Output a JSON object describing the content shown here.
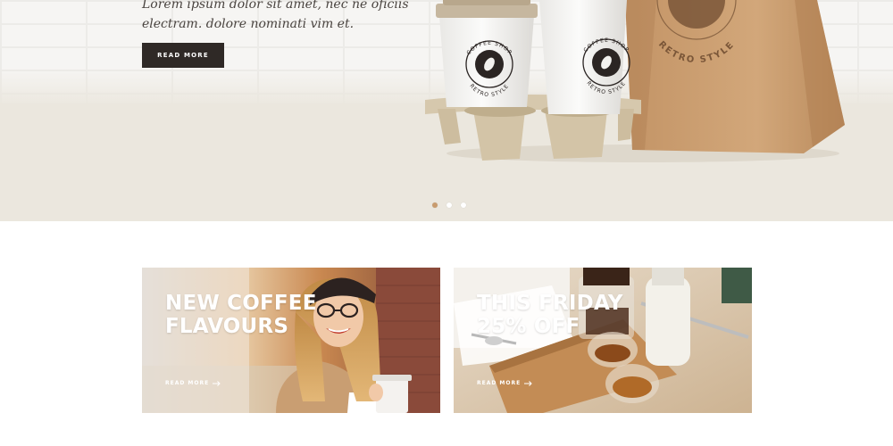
{
  "hero": {
    "text_line1": "Lorem ipsum dolor sit amet, nec ne oficiis",
    "text_line2": "electram. dolore nominati vim et.",
    "button_label": "READ MORE",
    "products": {
      "cup_label_top": "COFFEE SHOP",
      "cup_label_bottom": "RETRO STYLE",
      "bag_label": "RETRO STYLE"
    },
    "slider": {
      "count": 3,
      "active_index": 0
    }
  },
  "promos": [
    {
      "title_line1": "NEW COFFEE",
      "title_line2": "FLAVOURS",
      "link_label": "READ MORE"
    },
    {
      "title_line1": "THIS FRIDAY",
      "title_line2": "25% OFF",
      "link_label": "READ MORE"
    }
  ],
  "colors": {
    "accent": "#c89b6e",
    "button_dark": "#2f2926",
    "hero_floor": "#ebe7de",
    "text": "#4a4440"
  }
}
